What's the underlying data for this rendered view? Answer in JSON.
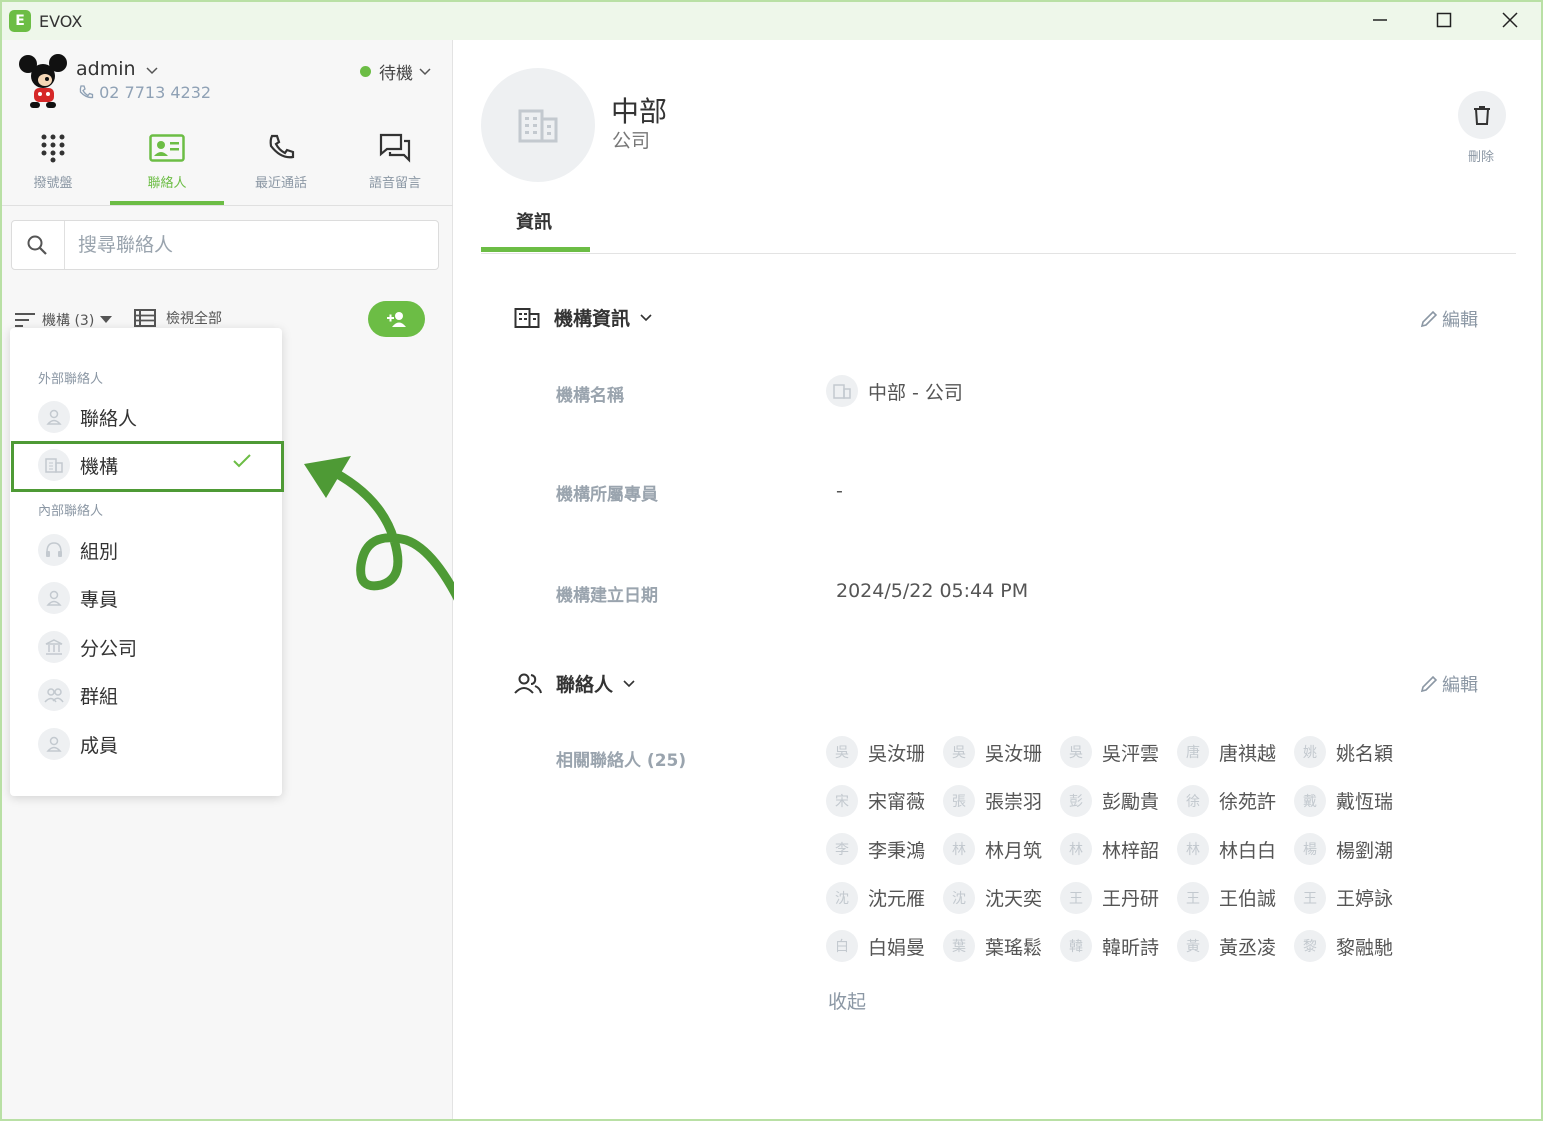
{
  "window": {
    "title": "EVOX",
    "logo_letter": "E",
    "minimize": "—",
    "maximize": "☐",
    "close": "✕"
  },
  "user": {
    "name": "admin",
    "phone": "02 7713 4232",
    "status": "待機",
    "status_color": "#6cbd45"
  },
  "nav_tabs": [
    {
      "label": "撥號盤",
      "icon": "dialpad-icon"
    },
    {
      "label": "聯絡人",
      "icon": "contact-card-icon",
      "active": true
    },
    {
      "label": "最近通話",
      "icon": "phone-icon"
    },
    {
      "label": "語音留言",
      "icon": "voicemail-icon"
    }
  ],
  "search": {
    "placeholder": "搜尋聯絡人"
  },
  "filter": {
    "label": "機構 (3)",
    "view_all": "檢視全部"
  },
  "menu": {
    "external_heading": "外部聯絡人",
    "internal_heading": "內部聯絡人",
    "items": [
      {
        "label": "聯絡人",
        "icon": "person-icon"
      },
      {
        "label": "機構",
        "icon": "building-icon",
        "selected": true
      },
      {
        "label": "組別",
        "icon": "headset-icon"
      },
      {
        "label": "專員",
        "icon": "person-icon"
      },
      {
        "label": "分公司",
        "icon": "bank-icon"
      },
      {
        "label": "群組",
        "icon": "people-icon"
      },
      {
        "label": "成員",
        "icon": "person-icon"
      }
    ]
  },
  "org": {
    "name": "中部",
    "type": "公司",
    "delete_label": "刪除",
    "tab": "資訊"
  },
  "org_info": {
    "title": "機構資訊",
    "edit": "編輯",
    "fields": [
      {
        "label": "機構名稱",
        "value": "中部 - 公司"
      },
      {
        "label": "機構所屬專員",
        "value": "-"
      },
      {
        "label": "機構建立日期",
        "value": "2024/5/22 05:44 PM"
      }
    ]
  },
  "contacts": {
    "title": "聯絡人",
    "edit": "編輯",
    "related_label": "相關聯絡人 (25)",
    "collapse": "收起",
    "list": [
      {
        "initial": "吳",
        "name": "吳汝珊"
      },
      {
        "initial": "吳",
        "name": "吳汝珊"
      },
      {
        "initial": "吳",
        "name": "吳泙雲"
      },
      {
        "initial": "唐",
        "name": "唐祺越"
      },
      {
        "initial": "姚",
        "name": "姚名穎"
      },
      {
        "initial": "宋",
        "name": "宋甯薇"
      },
      {
        "initial": "張",
        "name": "張崇羽"
      },
      {
        "initial": "彭",
        "name": "彭勵貴"
      },
      {
        "initial": "徐",
        "name": "徐苑許"
      },
      {
        "initial": "戴",
        "name": "戴恆瑞"
      },
      {
        "initial": "李",
        "name": "李秉鴻"
      },
      {
        "initial": "林",
        "name": "林月筑"
      },
      {
        "initial": "林",
        "name": "林梓韶"
      },
      {
        "initial": "林",
        "name": "林白白"
      },
      {
        "initial": "楊",
        "name": "楊劉潮"
      },
      {
        "initial": "沈",
        "name": "沈元雁"
      },
      {
        "initial": "沈",
        "name": "沈天奕"
      },
      {
        "initial": "王",
        "name": "王丹研"
      },
      {
        "initial": "王",
        "name": "王伯誠"
      },
      {
        "initial": "王",
        "name": "王婷詠"
      },
      {
        "initial": "白",
        "name": "白娟曼"
      },
      {
        "initial": "葉",
        "name": "葉瑤鬆"
      },
      {
        "initial": "韓",
        "name": "韓昕詩"
      },
      {
        "initial": "黃",
        "name": "黃丞凌"
      },
      {
        "initial": "黎",
        "name": "黎融馳"
      }
    ]
  },
  "accent_color": "#6cbd45"
}
